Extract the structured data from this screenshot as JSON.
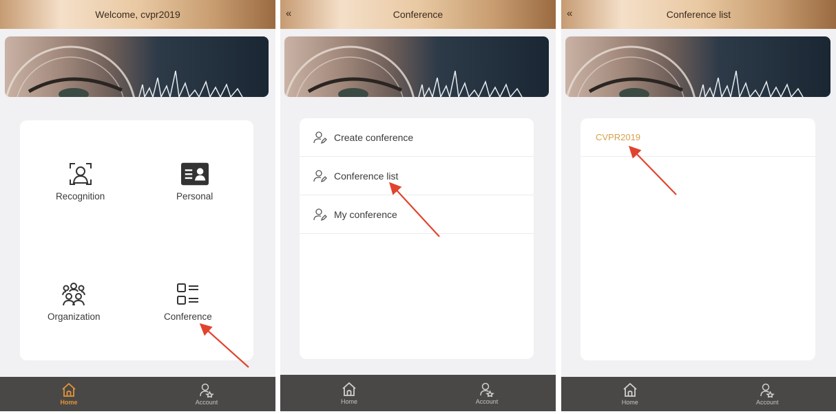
{
  "colors": {
    "accent": "#e49536",
    "list_text": "#d6a14b",
    "tabbar": "#4a4847",
    "arrow": "#e0442f"
  },
  "screen1": {
    "header": {
      "title": "Welcome, cvpr2019"
    },
    "grid": [
      {
        "label": "Recognition",
        "icon": "face-scan-icon"
      },
      {
        "label": "Personal",
        "icon": "id-card-icon"
      },
      {
        "label": "Organization",
        "icon": "people-group-icon"
      },
      {
        "label": "Conference",
        "icon": "list-icon"
      }
    ],
    "tabs": [
      {
        "label": "Home",
        "icon": "home-icon",
        "active": true
      },
      {
        "label": "Account",
        "icon": "account-icon",
        "active": false
      }
    ]
  },
  "screen2": {
    "header": {
      "title": "Conference",
      "back": "«"
    },
    "menu": [
      {
        "label": "Create conference",
        "icon": "user-edit-icon"
      },
      {
        "label": "Conference list",
        "icon": "user-edit-icon"
      },
      {
        "label": "My conference",
        "icon": "user-edit-icon"
      }
    ],
    "tabs": [
      {
        "label": "Home",
        "icon": "home-icon",
        "active": false
      },
      {
        "label": "Account",
        "icon": "account-icon",
        "active": false
      }
    ]
  },
  "screen3": {
    "header": {
      "title": "Conference list",
      "back": "«"
    },
    "list": [
      {
        "label": "CVPR2019"
      }
    ],
    "tabs": [
      {
        "label": "Home",
        "icon": "home-icon",
        "active": false
      },
      {
        "label": "Account",
        "icon": "account-icon",
        "active": false
      }
    ]
  }
}
